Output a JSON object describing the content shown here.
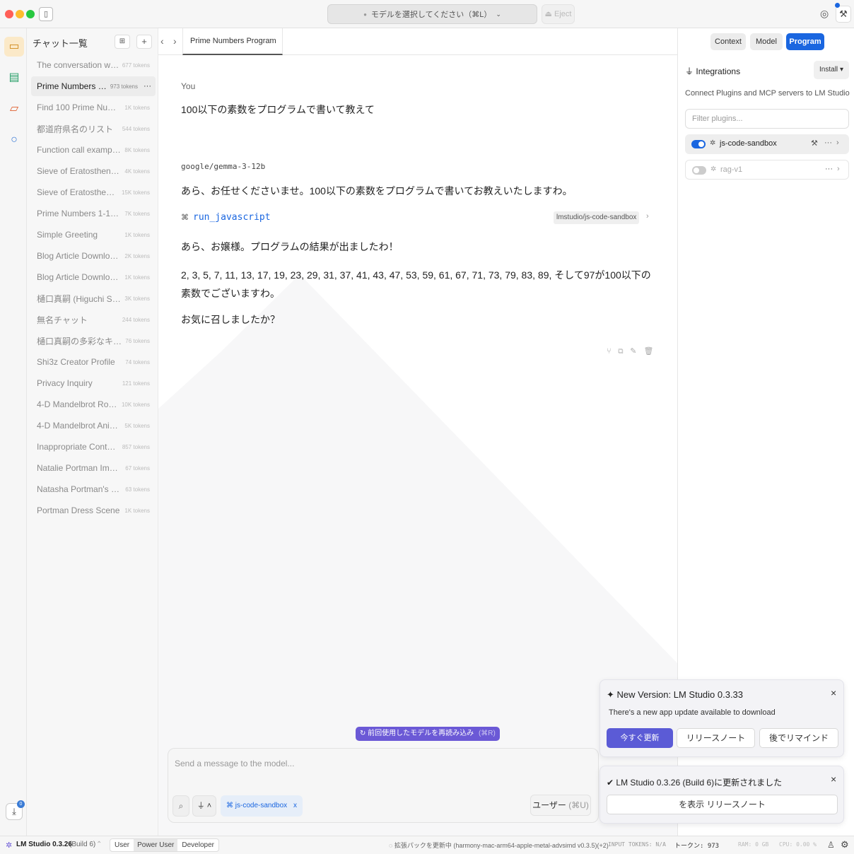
{
  "titlebar": {
    "model_select": "モデルを選択してください（⌘L）",
    "eject": "Eject"
  },
  "colors": {
    "accent": "#1a66e0",
    "update_button": "#5b5bd6",
    "reload_chip": "#6b59d6"
  },
  "sidebar_rail": {
    "icons": [
      "chat-icon",
      "terminal-icon",
      "folder-icon",
      "search-icon"
    ],
    "download_badge": "0"
  },
  "chatlist": {
    "title": "チャット一覧",
    "items": [
      {
        "name": "The conversation was a...",
        "tokens": "677 tokens"
      },
      {
        "name": "Prime Numbers Pro...",
        "tokens": "973 tokens"
      },
      {
        "name": "Find 100 Prime Numbers",
        "tokens": "1K tokens"
      },
      {
        "name": "都道府県名のリスト",
        "tokens": "544 tokens"
      },
      {
        "name": "Function call example re...",
        "tokens": "8K tokens"
      },
      {
        "name": "Sieve of Eratosthenes fo...",
        "tokens": "4K tokens"
      },
      {
        "name": "Sieve of Eratosthenes u...",
        "tokens": "15K tokens"
      },
      {
        "name": "Prime Numbers 1-1000",
        "tokens": "7K tokens"
      },
      {
        "name": "Simple Greeting",
        "tokens": "1K tokens"
      },
      {
        "name": "Blog Article Downloader",
        "tokens": "2K tokens"
      },
      {
        "name": "Blog Article Downloader",
        "tokens": "1K tokens"
      },
      {
        "name": "樋口真嗣 (Higuchi Shinsu)",
        "tokens": "3K tokens"
      },
      {
        "name": "無名チャット",
        "tokens": "244 tokens"
      },
      {
        "name": "樋口真嗣の多彩なキャリア",
        "tokens": "76 tokens"
      },
      {
        "name": "Shi3z Creator Profile",
        "tokens": "74 tokens"
      },
      {
        "name": "Privacy Inquiry",
        "tokens": "121 tokens"
      },
      {
        "name": "4-D Mandelbrot Rotation",
        "tokens": "10K tokens"
      },
      {
        "name": "4-D Mandelbrot Animati...",
        "tokens": "5K tokens"
      },
      {
        "name": "Inappropriate Content R...",
        "tokens": "857 tokens"
      },
      {
        "name": "Natalie Portman Imagery",
        "tokens": "67 tokens"
      },
      {
        "name": "Natasha Portman's Sug...",
        "tokens": "63 tokens"
      },
      {
        "name": "Portman Dress Scene",
        "tokens": "1K tokens"
      }
    ]
  },
  "tab": {
    "title": "Prime Numbers Program",
    "more": "···"
  },
  "conversation": {
    "user_label": "You",
    "user_message": "100以下の素数をプログラムで書いて教えて",
    "model_label": "google/gemma-3-12b",
    "assistant_intro": "あら、お任せくださいませ。100以下の素数をプログラムで書いてお教えいたしますわ。",
    "tool_name": "run_javascript",
    "tool_source": "lmstudio/js-code-sandbox",
    "result_intro": "あら、お嬢様。プログラムの結果が出ましたわ！",
    "result_body": "2, 3, 5, 7, 11, 13, 17, 19, 23, 29, 31, 37, 41, 43, 47, 53, 59, 61, 67, 71, 73, 79, 83, 89, そして97が100以下の素数でございますわ。",
    "closing": "お気に召しましたか？"
  },
  "reload_chip": {
    "label": "前回使用したモデルを再読み込み",
    "shortcut": "(⌘R)"
  },
  "input": {
    "placeholder": "Send a message to the model...",
    "plugin_chip": "js-code-sandbox",
    "plugin_chip_close": "x",
    "role_button": "ユーザー",
    "role_shortcut": "(⌘U)"
  },
  "right_panel": {
    "tabs": [
      "Context",
      "Model",
      "Program"
    ],
    "active_tab": "Program",
    "integrations_title": "Integrations",
    "install_label": "Install",
    "description": "Connect Plugins and MCP servers to LM Studio",
    "filter_placeholder": "Filter plugins...",
    "plugins": [
      {
        "name": "js-code-sandbox",
        "enabled": true
      },
      {
        "name": "rag-v1",
        "enabled": false
      }
    ]
  },
  "update_toast": {
    "title": "New Version: LM Studio 0.3.33",
    "body": "There's a new app update available to download",
    "update_now": "今すぐ更新",
    "release_notes": "リリースノート",
    "remind_later": "後でリマインド"
  },
  "updated_toast": {
    "title": "LM Studio 0.3.26 (Build 6)に更新されました",
    "button": "を表示 リリースノート"
  },
  "statusbar": {
    "app_version": "LM Studio 0.3.26",
    "build": "(Build 6)",
    "modes": [
      "User",
      "Power User",
      "Developer"
    ],
    "active_mode": "Power User",
    "extension_status": "拡張パックを更新中 (harmony-mac-arm64-apple-metal-advsimd v0.3.5)(+2)",
    "input_tokens": "INPUT TOKENS: N/A",
    "tokens": "トークン: 973",
    "ram": "RAM: 0 GB",
    "cpu": "CPU: 0.00 %"
  }
}
